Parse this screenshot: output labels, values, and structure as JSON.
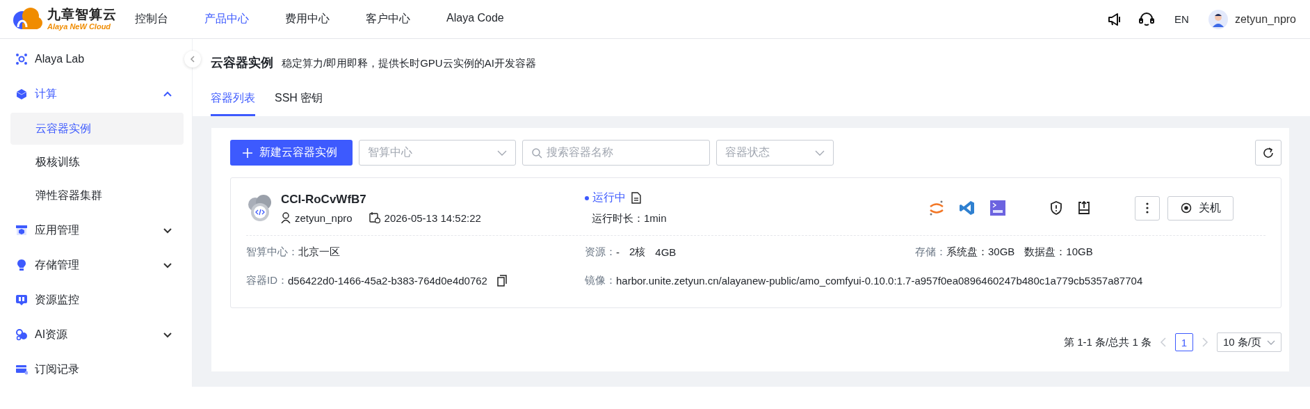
{
  "header": {
    "logo": {
      "title": "九章智算云",
      "subtitle": "Alaya NeW Cloud"
    },
    "nav": [
      {
        "label": "控制台",
        "selected": false
      },
      {
        "label": "产品中心",
        "selected": true
      },
      {
        "label": "费用中心",
        "selected": false
      },
      {
        "label": "客户中心",
        "selected": false
      },
      {
        "label": "Alaya Code",
        "selected": false
      }
    ],
    "language": "EN",
    "user": "zetyun_npro"
  },
  "sidebar": {
    "items": [
      {
        "label": "Alaya Lab",
        "kind": "link",
        "selected": false
      },
      {
        "label": "计算",
        "kind": "group",
        "expanded": true,
        "selected": true,
        "children": [
          {
            "label": "云容器实例",
            "selected": true
          },
          {
            "label": "极核训练",
            "selected": false
          },
          {
            "label": "弹性容器集群",
            "selected": false
          }
        ]
      },
      {
        "label": "应用管理",
        "kind": "group",
        "expanded": false,
        "selected": false
      },
      {
        "label": "存储管理",
        "kind": "group",
        "expanded": false,
        "selected": false
      },
      {
        "label": "资源监控",
        "kind": "link",
        "selected": false
      },
      {
        "label": "AI资源",
        "kind": "group",
        "expanded": false,
        "selected": false
      },
      {
        "label": "订阅记录",
        "kind": "link",
        "selected": false
      }
    ]
  },
  "page": {
    "title": "云容器实例",
    "subtitle": "稳定算力/即用即释，提供长时GPU云实例的AI开发容器"
  },
  "tabs": [
    {
      "label": "容器列表",
      "selected": true
    },
    {
      "label": "SSH 密钥",
      "selected": false
    }
  ],
  "toolbar": {
    "create_button": "新建云容器实例",
    "filters": [
      {
        "kind": "select",
        "placeholder": "智算中心"
      },
      {
        "kind": "search",
        "placeholder": "搜索容器名称"
      },
      {
        "kind": "select",
        "placeholder": "容器状态"
      }
    ]
  },
  "instances": [
    {
      "name": "CCI-RoCvWfB7",
      "owner": "zetyun_npro",
      "created": "2026-05-13 14:52:22",
      "status": {
        "label": "运行中"
      },
      "runtime": "运行时长：1min",
      "shutdown_button": "关机",
      "details": [
        {
          "label": "智算中心：",
          "values": [
            "北京一区"
          ]
        },
        {
          "label": "资源：",
          "values": [
            "-",
            "2核",
            "4GB"
          ]
        },
        {
          "label": "存储：",
          "values": [
            "系统盘：30GB",
            "数据盘：10GB"
          ]
        },
        {
          "label": "容器ID：",
          "values": [
            "d56422d0-1466-45a2-b383-764d0e4d0762"
          ],
          "copy": true
        },
        {
          "label": "镜像：",
          "values": [
            "harbor.unite.zetyun.cn/alayanew-public/amo_comfyui-0.10.0:1.7-a957f0ea0896460247b480c1a779cb5357a87704"
          ],
          "wide": true
        }
      ]
    }
  ],
  "pagination": {
    "summary": "第 1-1 条/总共 1 条",
    "pages": [
      {
        "label": "1",
        "selected": true
      }
    ],
    "page_size": "10 条/页"
  }
}
